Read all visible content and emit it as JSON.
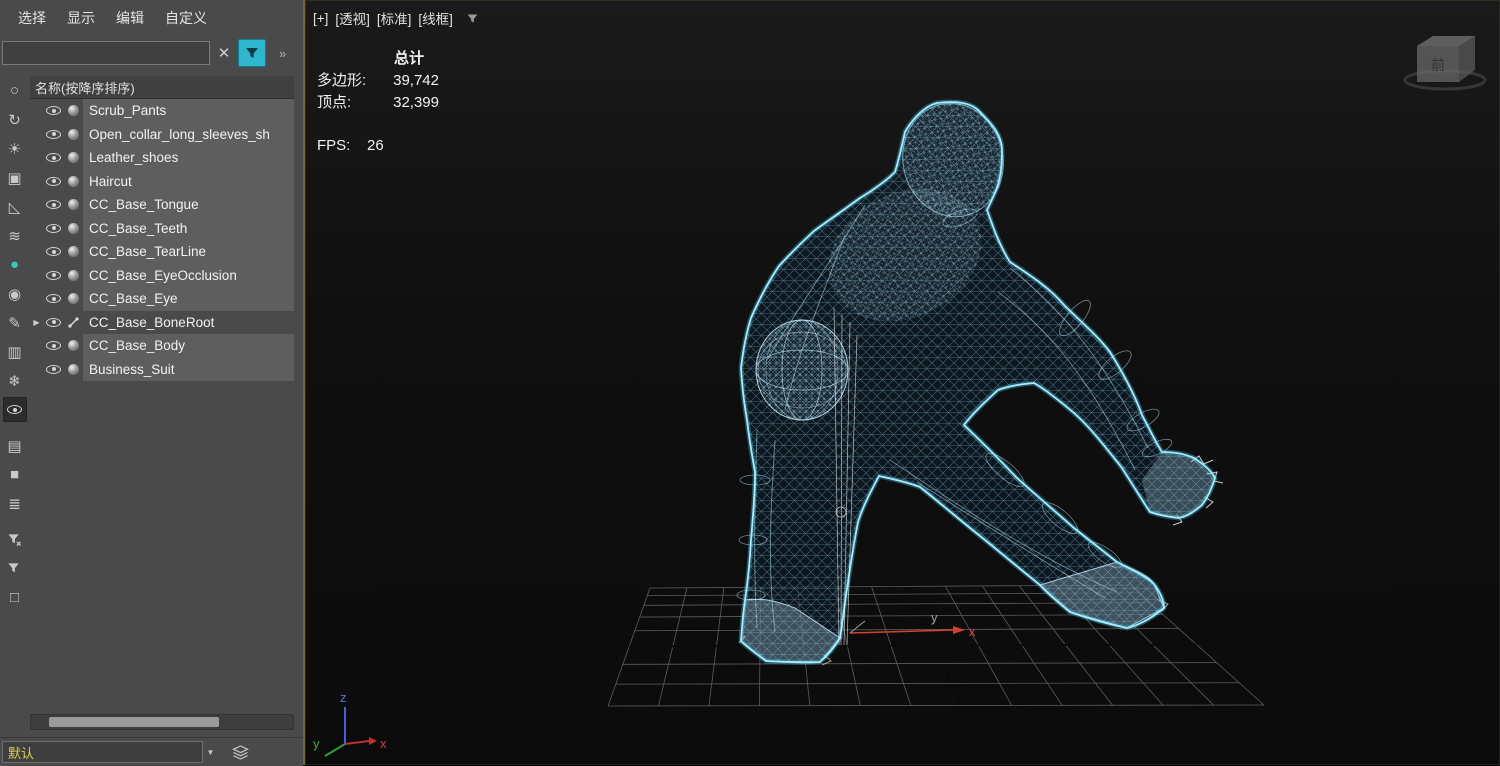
{
  "explorer": {
    "menu": [
      "选择",
      "显示",
      "编辑",
      "自定义"
    ],
    "search": {
      "value": "",
      "placeholder": "",
      "clear_icon": "✕",
      "overflow_icon": "»"
    },
    "tree_header": "名称(按降序排序)",
    "rows": [
      {
        "name": "Scrub_Pants",
        "selected": true,
        "type": "mesh"
      },
      {
        "name": "Open_collar_long_sleeves_sh",
        "selected": true,
        "type": "mesh"
      },
      {
        "name": "Leather_shoes",
        "selected": true,
        "type": "mesh"
      },
      {
        "name": "Haircut",
        "selected": true,
        "type": "mesh"
      },
      {
        "name": "CC_Base_Tongue",
        "selected": true,
        "type": "mesh"
      },
      {
        "name": "CC_Base_Teeth",
        "selected": true,
        "type": "mesh"
      },
      {
        "name": "CC_Base_TearLine",
        "selected": true,
        "type": "mesh"
      },
      {
        "name": "CC_Base_EyeOcclusion",
        "selected": true,
        "type": "mesh"
      },
      {
        "name": "CC_Base_Eye",
        "selected": true,
        "type": "mesh"
      },
      {
        "name": "CC_Base_BoneRoot",
        "selected": false,
        "type": "bone",
        "expandable": true
      },
      {
        "name": "CC_Base_Body",
        "selected": true,
        "type": "mesh"
      },
      {
        "name": "Business_Suit",
        "selected": true,
        "type": "mesh"
      }
    ],
    "footer": {
      "layer_name": "默认",
      "dropdown_icon": "▼"
    }
  },
  "side_toolbar": [
    {
      "name": "display-none",
      "glyph": "○"
    },
    {
      "name": "display-refresh",
      "glyph": "↻"
    },
    {
      "name": "display-lights",
      "glyph": "☀"
    },
    {
      "name": "display-cameras",
      "glyph": "▣"
    },
    {
      "name": "display-helpers",
      "glyph": "◺"
    },
    {
      "name": "display-spacewarps",
      "glyph": "≋"
    },
    {
      "name": "display-geometry",
      "glyph": "●",
      "teal": true
    },
    {
      "name": "display-shapes",
      "glyph": "◉"
    },
    {
      "name": "display-bones",
      "glyph": "✎"
    },
    {
      "name": "display-containers",
      "glyph": "▥"
    },
    {
      "name": "display-frozen",
      "glyph": "❄"
    },
    {
      "name": "display-hidden",
      "glyph": "eye",
      "pressed": true
    },
    {
      "name": "column-chooser",
      "glyph": "▤",
      "gap": true
    },
    {
      "name": "lock-cell-editing",
      "glyph": "■"
    },
    {
      "name": "sync-selection",
      "glyph": "≣"
    },
    {
      "name": "clear-filter",
      "glyph": "funnel-x",
      "gap": true
    },
    {
      "name": "filter",
      "glyph": "funnel"
    },
    {
      "name": "pick-folder",
      "glyph": "□"
    }
  ],
  "viewport": {
    "labels": [
      "[+]",
      "[透视]",
      "[标准]",
      "[线框]"
    ],
    "stats": {
      "total_label": "总计",
      "polygons_label": "多边形:",
      "polygons_value": "39,742",
      "vertices_label": "顶点:",
      "vertices_value": "32,399",
      "fps_label": "FPS:",
      "fps_value": "26"
    },
    "gizmo": {
      "x": "x",
      "y": "y"
    },
    "axis": {
      "x": "x",
      "y": "y",
      "z": "z"
    },
    "viewcube": {
      "front_label": "前"
    }
  },
  "colors": {
    "selection_wire": "#9feaff",
    "filter_button": "#2eb6cc",
    "layer_text": "#ddcf56",
    "axis_x": "#c03028",
    "axis_y": "#2f9e2f",
    "axis_z": "#4b5cde"
  }
}
